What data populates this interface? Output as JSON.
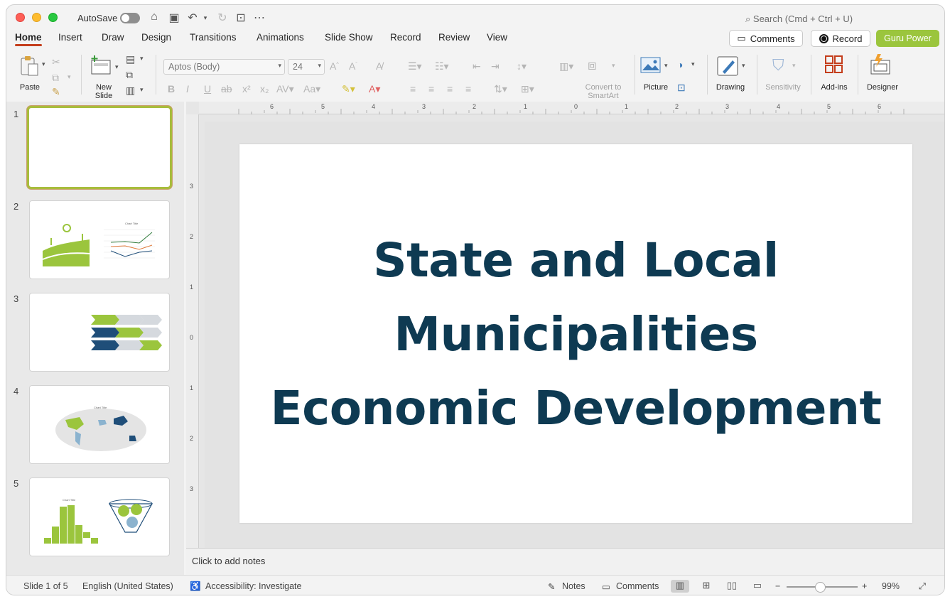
{
  "titlebar": {
    "autosave_label": "AutoSave",
    "search_placeholder": "Search (Cmd + Ctrl + U)"
  },
  "tabs": [
    "Home",
    "Insert",
    "Draw",
    "Design",
    "Transitions",
    "Animations",
    "Slide Show",
    "Record",
    "Review",
    "View"
  ],
  "header_buttons": {
    "comments": "Comments",
    "record": "Record",
    "guru": "Guru Power"
  },
  "ribbon": {
    "paste": "Paste",
    "new_slide_1": "New",
    "new_slide_2": "Slide",
    "font_name": "Aptos (Body)",
    "font_size": "24",
    "convert_1": "Convert to",
    "convert_2": "SmartArt",
    "picture": "Picture",
    "drawing": "Drawing",
    "sensitivity": "Sensitivity",
    "addins": "Add-ins",
    "designer": "Designer"
  },
  "thumbnails": [
    "1",
    "2",
    "3",
    "4",
    "5"
  ],
  "slide": {
    "title_lines": [
      "State and Local",
      "Municipalities",
      "Economic Development"
    ]
  },
  "notes_placeholder": "Click to add notes",
  "status": {
    "slide_count": "Slide 1 of 5",
    "language": "English (United States)",
    "accessibility": "Accessibility: Investigate",
    "notes": "Notes",
    "comments": "Comments",
    "zoom": "99%"
  },
  "colors": {
    "title": "#0e3a52",
    "accent_green": "#9bc53d",
    "tab_underline": "#c43e1c"
  }
}
